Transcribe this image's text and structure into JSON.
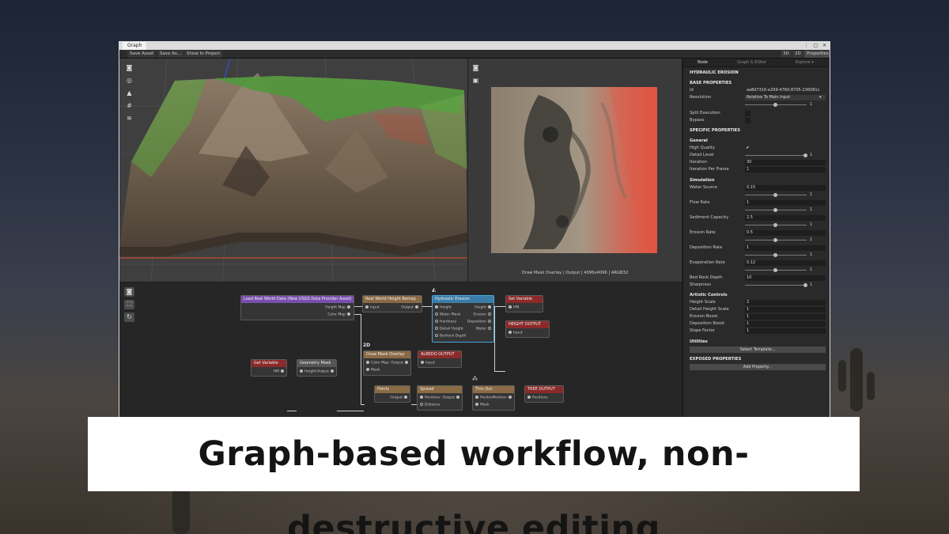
{
  "window": {
    "tab_title": "Graph",
    "window_controls": "⋮ □ ✕"
  },
  "toolbar": {
    "save_asset": "Save Asset",
    "save_as": "Save As...",
    "show_in_project": "Show In Project",
    "view_3d": "3D",
    "view_2d": "2D",
    "properties": "Properties"
  },
  "preview2d": {
    "status": "Draw Mask Overlay | Output | 4096x4096 | ARGB32"
  },
  "graph": {
    "badge_2d": "2D",
    "nodes": {
      "load": {
        "title": "Load Real World Data (New USGS Data Provider Asset)",
        "out1": "Height Map",
        "out2": "Color Map"
      },
      "remap": {
        "title": "Real World Height Remap",
        "in1": "Input",
        "out1": "Output"
      },
      "erosion": {
        "title": "Hydraulic Erosion",
        "in": [
          "Height",
          "Water Mask",
          "Hardness",
          "Detail Height",
          "Bedrock Depth"
        ],
        "out": [
          "Height",
          "Erosion",
          "Deposition",
          "Water"
        ]
      },
      "setvar": {
        "title": "Set Variable",
        "in1": "HM"
      },
      "height_out": {
        "title": "HEIGHT OUTPUT",
        "in1": "Input"
      },
      "drawmask": {
        "title": "Draw Mask Overlay",
        "in1": "Color Map",
        "in2": "Mask",
        "out1": "Output"
      },
      "albedo": {
        "title": "ALBEDO OUTPUT",
        "in1": "Input"
      },
      "getvar": {
        "title": "Get Variable",
        "out1": "HM"
      },
      "geomask": {
        "title": "Geometry Mask",
        "in1": "Height",
        "out1": "Output"
      },
      "points": {
        "title": "Points",
        "out1": "Output"
      },
      "spread": {
        "title": "Spread",
        "in1": "Positions",
        "in2": "Distance",
        "out1": "Output"
      },
      "thinout": {
        "title": "Thin Out",
        "in1": "Position",
        "in2": "Mask",
        "out1": "Position"
      },
      "tree": {
        "title": "TREE OUTPUT",
        "in1": "Positions"
      }
    }
  },
  "inspector": {
    "tabs": [
      "Node",
      "Graph & Editor",
      "Explore ▾"
    ],
    "node_title": "HYDRAULIC EROSION",
    "base_properties": "BASE PROPERTIES",
    "id_label": "Id",
    "id_value": "aa8d7316-e299-4760-8705-236081c",
    "resolution_label": "Resolution",
    "resolution_value": "Relative To Main Input",
    "resolution_mult": "1",
    "split_execution": "Split Execution",
    "bypass": "Bypass",
    "specific_properties": "SPECIFIC PROPERTIES",
    "general": "General",
    "high_quality": "High Quality",
    "high_quality_check": "✔",
    "detail_level": "Detail Level",
    "detail_level_value": "1",
    "iteration": "Iteration",
    "iteration_value": "30",
    "iteration_per_frame": "Iteration Per Frame",
    "iteration_per_frame_value": "1",
    "simulation": "Simulation",
    "water_source": "Water Source",
    "water_source_value": "0.15",
    "flow_rate": "Flow Rate",
    "flow_rate_value": "1",
    "sediment_capacity": "Sediment Capacity",
    "sediment_capacity_value": "2.5",
    "erosion_rate": "Erosion Rate",
    "erosion_rate_value": "0.5",
    "deposition_rate": "Deposition Rate",
    "deposition_rate_value": "1",
    "evaporation_rate": "Evaporation Rate",
    "evaporation_rate_value": "0.12",
    "bed_rock_depth": "Bed Rock Depth",
    "bed_rock_depth_value": "10",
    "sharpness": "Sharpness",
    "slider_mult": "1",
    "artistic_controls": "Artistic Controls",
    "height_scale": "Height Scale",
    "height_scale_value": "2",
    "detail_height_scale": "Detail Height Scale",
    "detail_height_scale_value": "1",
    "erosion_boost": "Erosion Boost",
    "erosion_boost_value": "1",
    "deposition_boost": "Deposition Boost",
    "deposition_boost_value": "1",
    "slope_factor": "Slope Factor",
    "slope_factor_value": "1",
    "utilities": "Utilities",
    "select_template": "Select Template...",
    "exposed_properties": "EXPOSED PROPERTIES",
    "add_property": "Add Property..."
  },
  "caption": "Graph-based workflow, non-destructive editing"
}
